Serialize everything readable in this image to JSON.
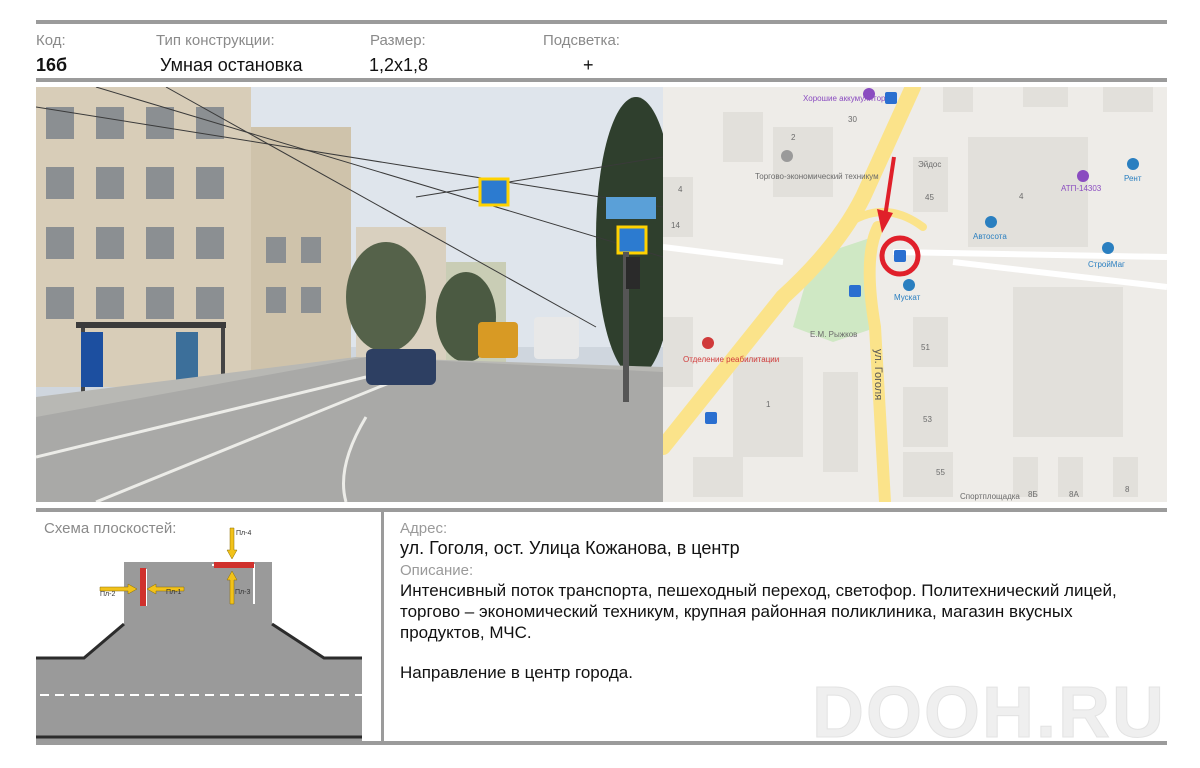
{
  "header": {
    "code_label": "Код:",
    "code_value": "16б",
    "type_label": "Тип конструкции:",
    "type_value": "Умная остановка",
    "size_label": "Размер:",
    "size_value": "1,2x1,8",
    "light_label": "Подсветка:",
    "light_value": "+"
  },
  "map": {
    "labels": {
      "akk": "Хорошие аккумуляторы",
      "tech": "Торгово-экономический техникум",
      "eidos": "Эйдос",
      "atp": "АТП-14303",
      "rent": "Рент",
      "avtosota": "Автосота",
      "stroymag": "СтройМаг",
      "muskat": "Мускат",
      "ryzhkov": "Е.М. Рыжков",
      "rehab": "Отделение реабилитации",
      "street": "ул. Гоголя",
      "sport": "Спортплощадка",
      "n2": "2",
      "n30": "30",
      "n45": "45",
      "n4": "4",
      "n4b": "4",
      "n14": "14",
      "n51": "51",
      "n1": "1",
      "n53": "53",
      "n55": "55",
      "n8b": "8Б",
      "n8a": "8А",
      "n8": "8"
    }
  },
  "scheme": {
    "title": "Схема плоскостей:",
    "planes": [
      "Пл-1",
      "Пл-2",
      "Пл-3",
      "Пл-4"
    ]
  },
  "address": {
    "label": "Адрес:",
    "value": "ул. Гоголя, ост. Улица Кожанова, в центр"
  },
  "description": {
    "label": "Описание:",
    "line1": "Интенсивный поток транспорта, пешеходный переход, светофор. Политехнический лицей,",
    "line2": "торгово – экономический техникум, крупная районная поликлиника, магазин вкусных",
    "line3": "продуктов, МЧС.",
    "line4": "Направление в центр города."
  },
  "watermark": "DOOH.RU",
  "colors": {
    "rule": "#9b9b9b",
    "road": "#9a9a9a",
    "plane_red": "#d0312d",
    "arrow_yellow": "#f2c21a",
    "map_road": "#fbe38a",
    "map_marker": "#e0202a"
  }
}
